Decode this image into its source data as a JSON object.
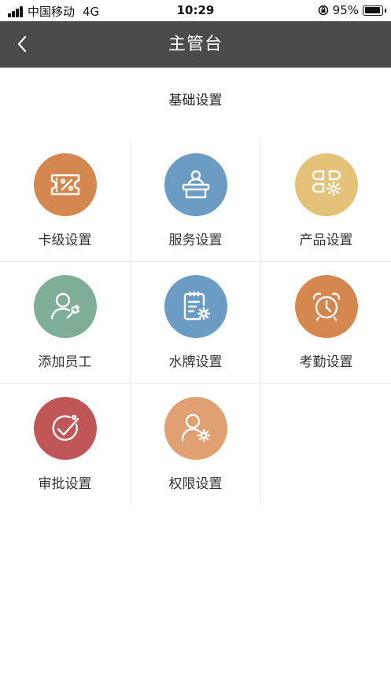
{
  "status_bar": {
    "carrier": "中国移动",
    "network": "4G",
    "time": "10:29",
    "battery": "95%",
    "battery_level": 0.95
  },
  "nav": {
    "title": "主管台"
  },
  "section": {
    "title": "基础设置"
  },
  "items": [
    {
      "label": "卡级设置",
      "icon": "coupon-percent-icon",
      "color": "#d4874f"
    },
    {
      "label": "服务设置",
      "icon": "reception-desk-icon",
      "color": "#6a9cc4"
    },
    {
      "label": "产品设置",
      "icon": "product-grid-gear-icon",
      "color": "#e4c27a"
    },
    {
      "label": "添加员工",
      "icon": "user-wrench-icon",
      "color": "#7fae96"
    },
    {
      "label": "水牌设置",
      "icon": "clipboard-gear-icon",
      "color": "#6a9cc4"
    },
    {
      "label": "考勤设置",
      "icon": "alarm-clock-icon",
      "color": "#d4874f"
    },
    {
      "label": "审批设置",
      "icon": "approval-wrench-icon",
      "color": "#c05656"
    },
    {
      "label": "权限设置",
      "icon": "user-gear-icon",
      "color": "#e1a071"
    }
  ]
}
